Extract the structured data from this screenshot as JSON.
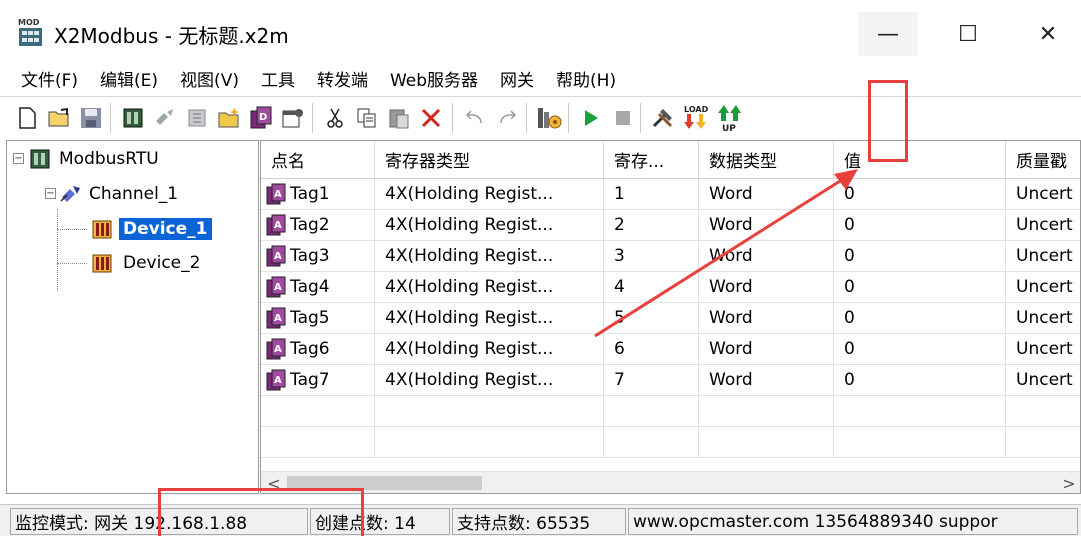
{
  "window": {
    "title": "X2Modbus - 无标题.x2m",
    "minimize": "—",
    "maximize": "☐",
    "close": "✕"
  },
  "menu": [
    "文件(F)",
    "编辑(E)",
    "视图(V)",
    "工具",
    "转发端",
    "Web服务器",
    "网关",
    "帮助(H)"
  ],
  "toolbar": {
    "icons": [
      "new-file",
      "open-folder",
      "save",
      "channel",
      "device",
      "tag",
      "import",
      "export",
      "properties",
      "cut",
      "copy",
      "paste",
      "delete",
      "undo",
      "redo",
      "monitor",
      "start",
      "stop",
      "tools",
      "download",
      "upload"
    ],
    "load_label": "LOAD",
    "up_label": "UP"
  },
  "tree": {
    "root": "ModbusRTU",
    "channel": "Channel_1",
    "devices": [
      "Device_1",
      "Device_2"
    ],
    "selected": "Device_1"
  },
  "table": {
    "columns": [
      "点名",
      "寄存器类型",
      "寄存...",
      "数据类型",
      "值",
      "质量戳"
    ],
    "rows": [
      {
        "name": "Tag1",
        "reg_type": "4X(Holding Regist...",
        "addr": "1",
        "data_type": "Word",
        "value": "0",
        "quality": "Uncert"
      },
      {
        "name": "Tag2",
        "reg_type": "4X(Holding Regist...",
        "addr": "2",
        "data_type": "Word",
        "value": "0",
        "quality": "Uncert"
      },
      {
        "name": "Tag3",
        "reg_type": "4X(Holding Regist...",
        "addr": "3",
        "data_type": "Word",
        "value": "0",
        "quality": "Uncert"
      },
      {
        "name": "Tag4",
        "reg_type": "4X(Holding Regist...",
        "addr": "4",
        "data_type": "Word",
        "value": "0",
        "quality": "Uncert"
      },
      {
        "name": "Tag5",
        "reg_type": "4X(Holding Regist...",
        "addr": "5",
        "data_type": "Word",
        "value": "0",
        "quality": "Uncert"
      },
      {
        "name": "Tag6",
        "reg_type": "4X(Holding Regist...",
        "addr": "6",
        "data_type": "Word",
        "value": "0",
        "quality": "Uncert"
      },
      {
        "name": "Tag7",
        "reg_type": "4X(Holding Regist...",
        "addr": "7",
        "data_type": "Word",
        "value": "0",
        "quality": "Uncert"
      }
    ]
  },
  "scroll": {
    "left": "<",
    "right": ">"
  },
  "status": {
    "mode": "监控模式: 网关 192.168.1.88",
    "created": "创建点数: 14",
    "supported": "支持点数: 65535",
    "contact": "www.opcmaster.com 13564889340 suppor"
  },
  "colors": {
    "selection": "#0a64d8",
    "annotation": "#e8403c",
    "start_green": "#1aa23a"
  }
}
